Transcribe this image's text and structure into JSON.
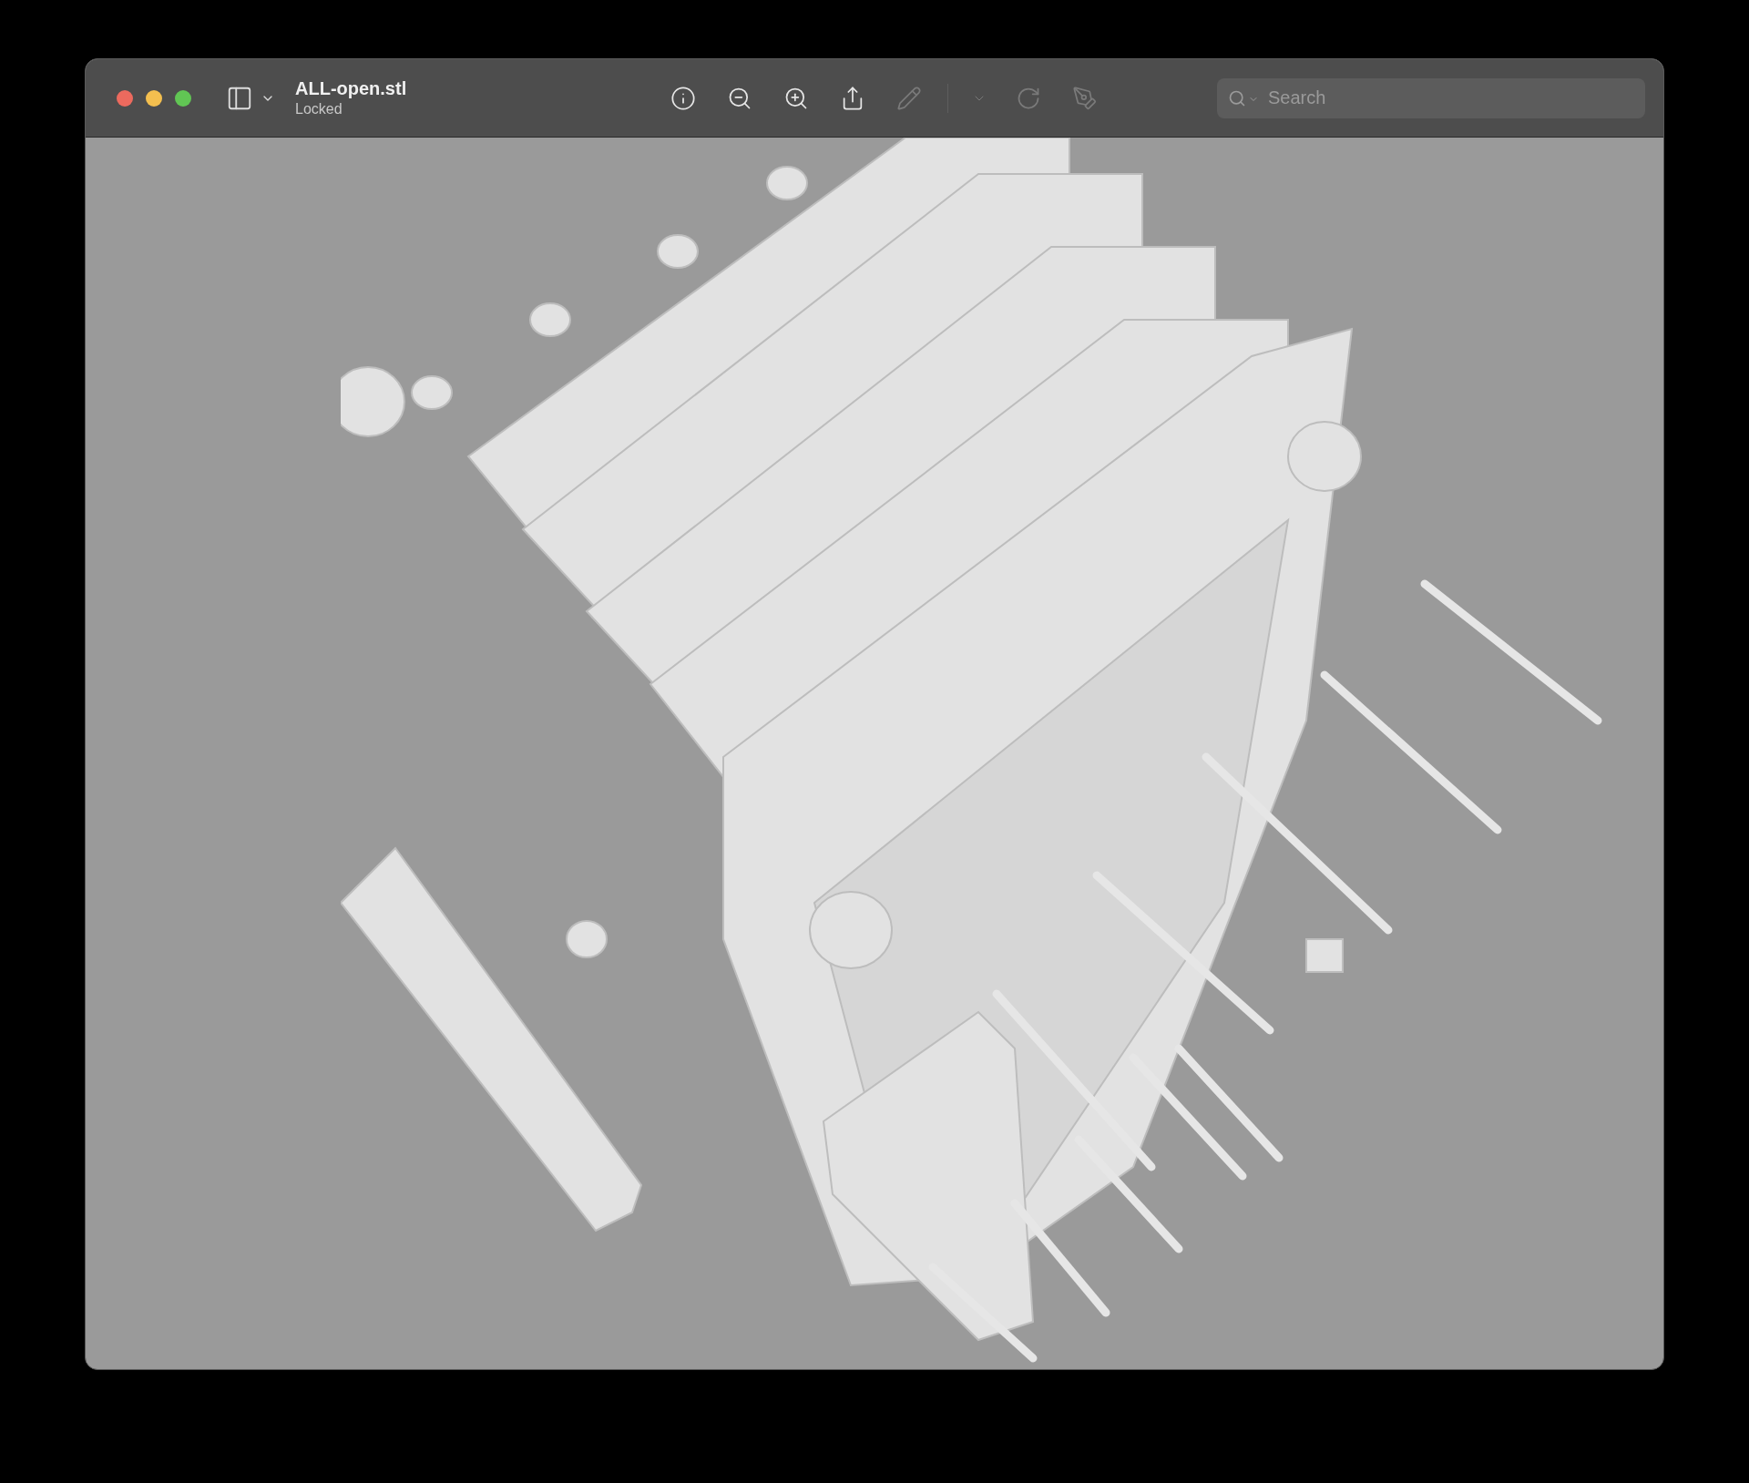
{
  "window": {
    "title": "ALL-open.stl",
    "subtitle": "Locked"
  },
  "toolbar": [
    {
      "kind": "info",
      "disabled": false
    },
    {
      "kind": "zoom-out",
      "disabled": false
    },
    {
      "kind": "zoom-in",
      "disabled": false
    },
    {
      "kind": "share",
      "disabled": false
    },
    {
      "kind": "markup",
      "disabled": true
    },
    {
      "kind": "divider",
      "disabled": true
    },
    {
      "kind": "chevron",
      "disabled": true
    },
    {
      "kind": "rotate",
      "disabled": true
    },
    {
      "kind": "annotate",
      "disabled": true
    }
  ],
  "search": {
    "placeholder": "Search"
  }
}
